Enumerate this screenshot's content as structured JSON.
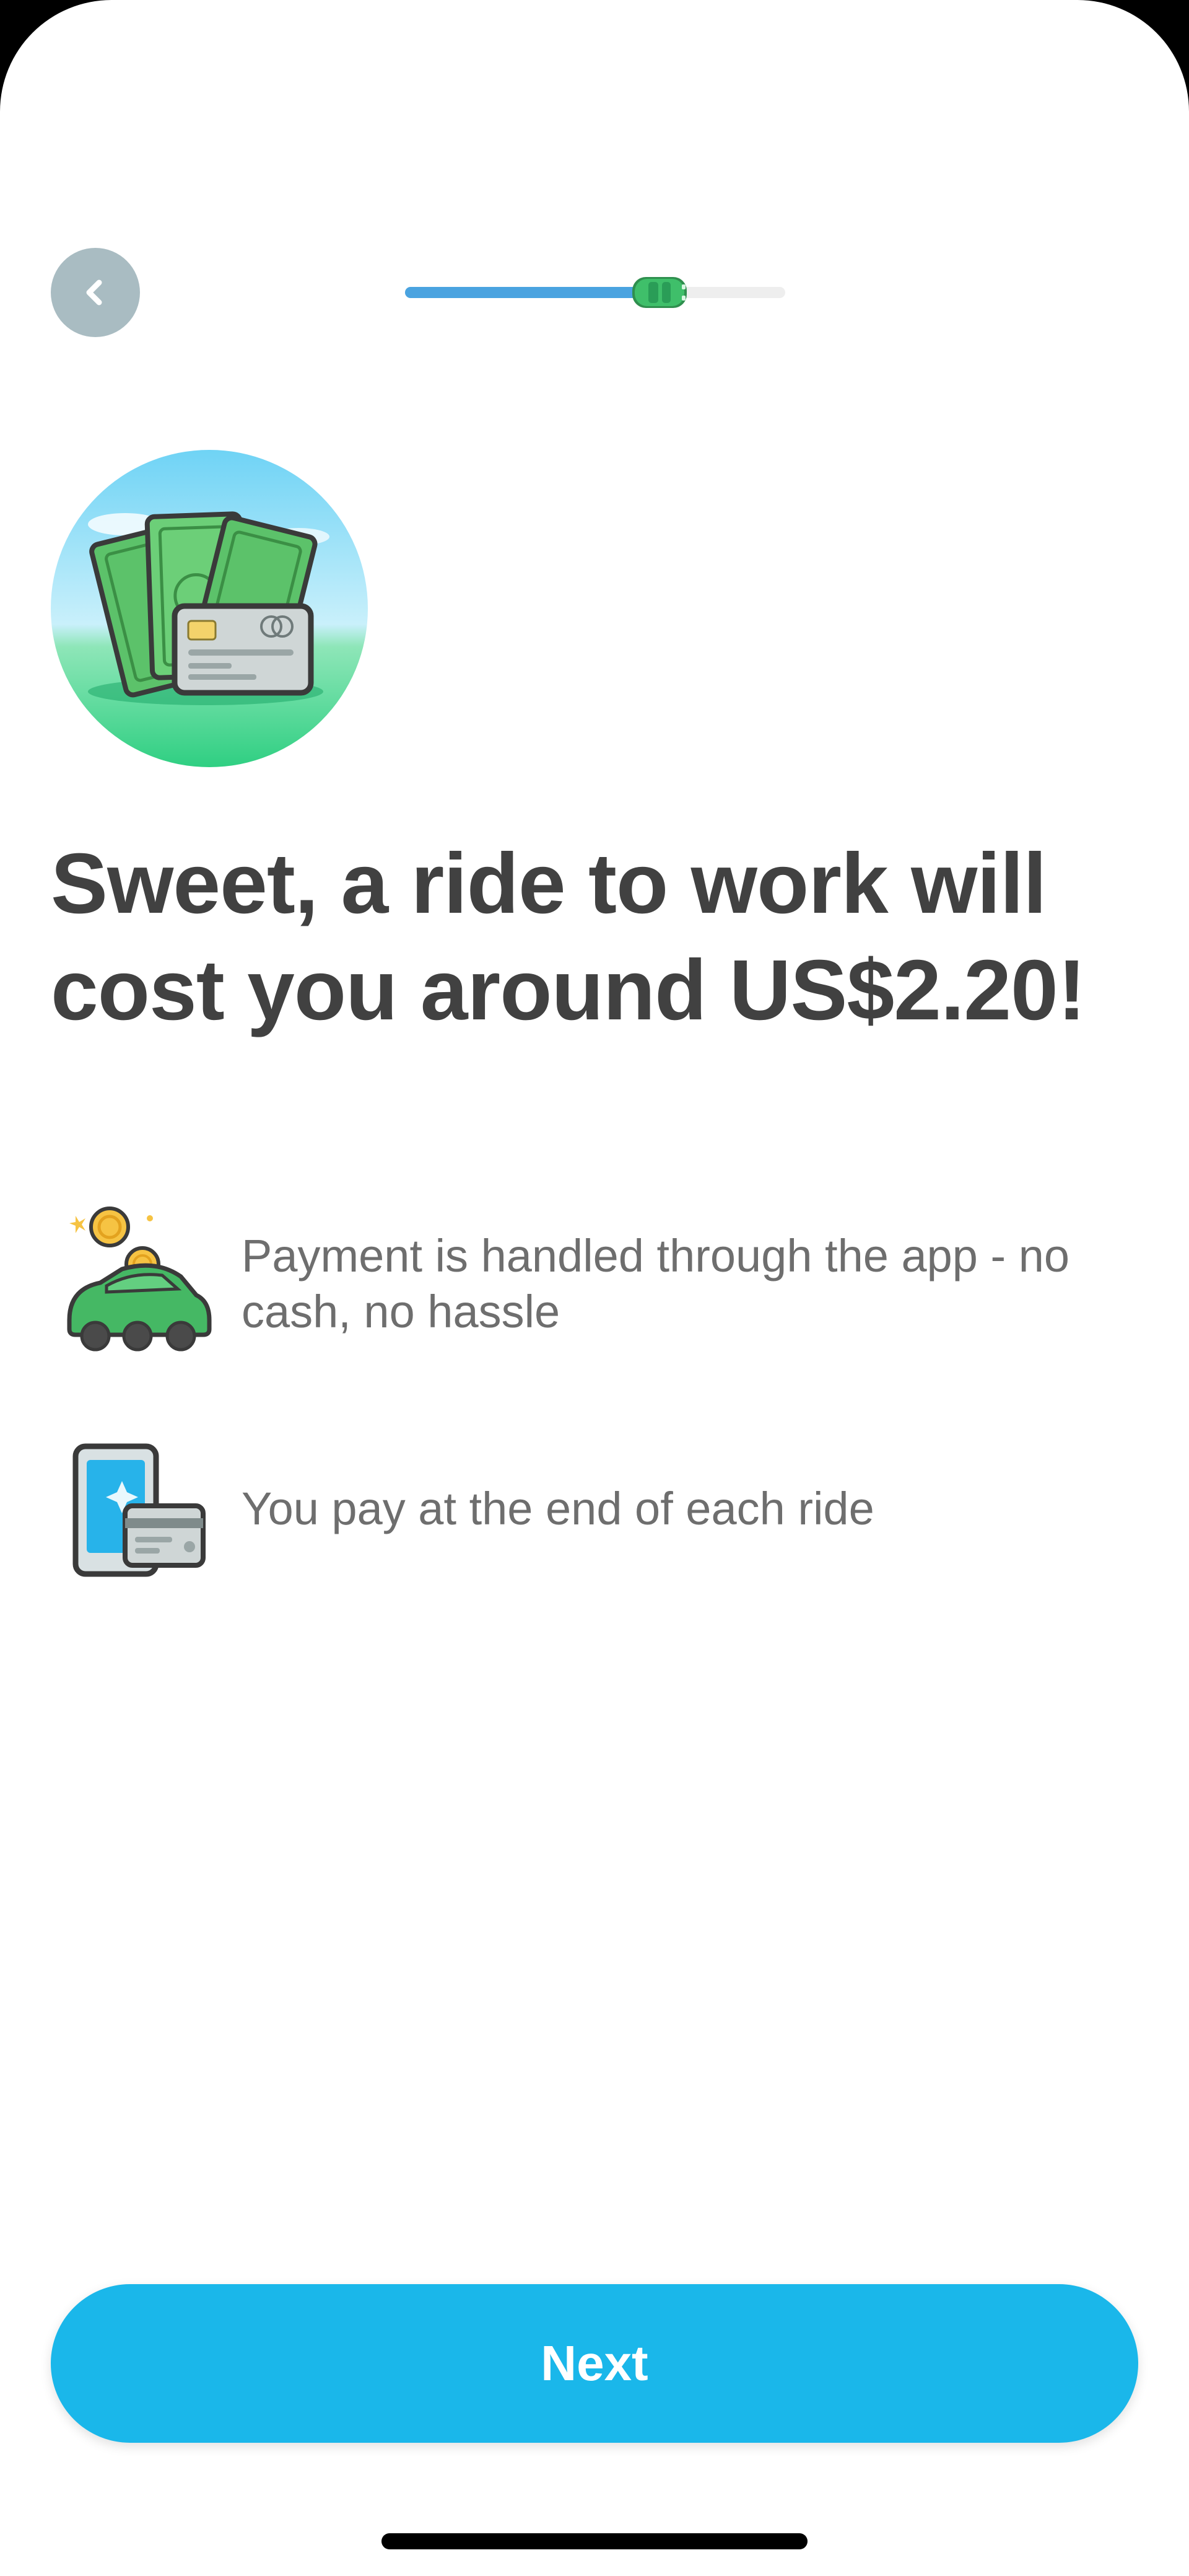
{
  "header": {
    "back_icon": "chevron-left-icon",
    "progress": {
      "fraction": 0.67,
      "marker_icon": "car-icon"
    }
  },
  "hero": {
    "illustration": "cash-and-card-illustration"
  },
  "main": {
    "headline": "Sweet, a ride to work will cost you around US$2.20!",
    "info_items": [
      {
        "icon": "car-piggybank-coins-icon",
        "text": " Payment is handled through the app - no cash, no hassle"
      },
      {
        "icon": "phone-card-icon",
        "text": "You pay at the end of each ride"
      }
    ]
  },
  "footer": {
    "next_label": "Next"
  },
  "colors": {
    "accent": "#1ab7ea",
    "progress": "#4aa3e0",
    "back_button": "#a9bcc2",
    "headline": "#414141",
    "body_text": "#6e6e6e"
  }
}
